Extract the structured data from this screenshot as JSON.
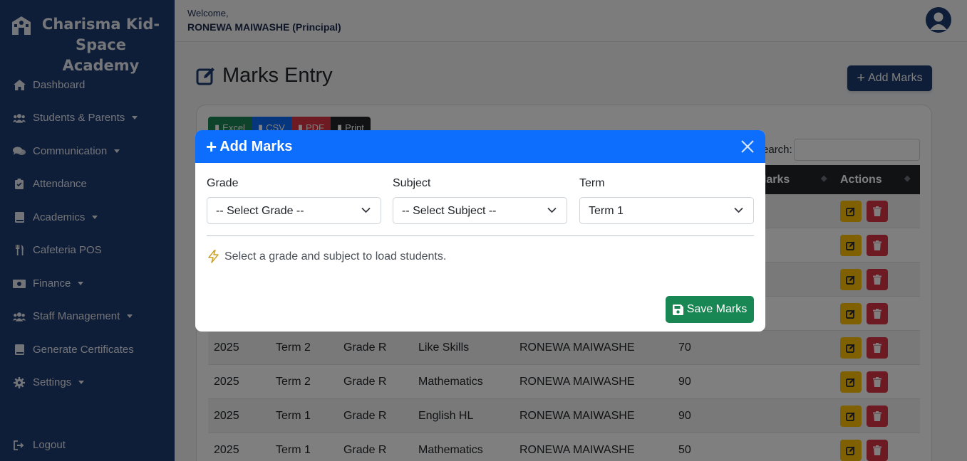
{
  "sidebar": {
    "brand": "Charisma Kid-Space Academy",
    "items": [
      {
        "label": "Dashboard",
        "icon": "home-icon",
        "dropdown": false
      },
      {
        "label": "Students & Parents",
        "icon": "users-icon",
        "dropdown": true
      },
      {
        "label": "Communication",
        "icon": "comments-icon",
        "dropdown": true
      },
      {
        "label": "Attendance",
        "icon": "clipboard-check-icon",
        "dropdown": false
      },
      {
        "label": "Academics",
        "icon": "book-icon",
        "dropdown": true
      },
      {
        "label": "Cafeteria POS",
        "icon": "utensils-icon",
        "dropdown": false
      },
      {
        "label": "Finance",
        "icon": "money-bill-icon",
        "dropdown": true
      },
      {
        "label": "Staff Management",
        "icon": "users-cog-icon",
        "dropdown": true
      },
      {
        "label": "Generate Certificates",
        "icon": "certificate-book-icon",
        "dropdown": false
      },
      {
        "label": "Settings",
        "icon": "gear-icon",
        "dropdown": true
      }
    ],
    "logout": "Logout"
  },
  "topbar": {
    "welcome": "Welcome,",
    "user": "RONEWA MAIWASHE (Principal)"
  },
  "main": {
    "title": "Marks Entry",
    "add_button": "Add Marks",
    "export": {
      "excel": "Excel",
      "csv": "CSV",
      "pdf": "PDF",
      "print": "Print"
    },
    "search_label": "Search:",
    "columns_visible": {
      "marks": "Marks",
      "actions": "Actions"
    },
    "rows": [
      {
        "year": "2025",
        "term": "Term 2",
        "grade": "Grade R",
        "subject": "Like Skills",
        "teacher": "RONEWA MAIWASHE",
        "marks": "70"
      },
      {
        "year": "2025",
        "term": "Term 2",
        "grade": "Grade R",
        "subject": "Mathematics",
        "teacher": "RONEWA MAIWASHE",
        "marks": "90"
      },
      {
        "year": "2025",
        "term": "Term 1",
        "grade": "Grade R",
        "subject": "English HL",
        "teacher": "RONEWA MAIWASHE",
        "marks": "90"
      },
      {
        "year": "2025",
        "term": "Term 1",
        "grade": "Grade R",
        "subject": "Mathematics",
        "teacher": "RONEWA MAIWASHE",
        "marks": "50"
      }
    ]
  },
  "modal": {
    "title": "Add Marks",
    "grade_label": "Grade",
    "grade_value": "-- Select Grade --",
    "subject_label": "Subject",
    "subject_value": "-- Select Subject --",
    "term_label": "Term",
    "term_value": "Term 1",
    "hint": "Select a grade and subject to load students.",
    "save": "Save Marks"
  },
  "colors": {
    "sidebar": "#1d3a70",
    "modal_header": "#0d6efd",
    "save": "#198754",
    "edit": "#ffc107",
    "delete": "#dc3545"
  }
}
